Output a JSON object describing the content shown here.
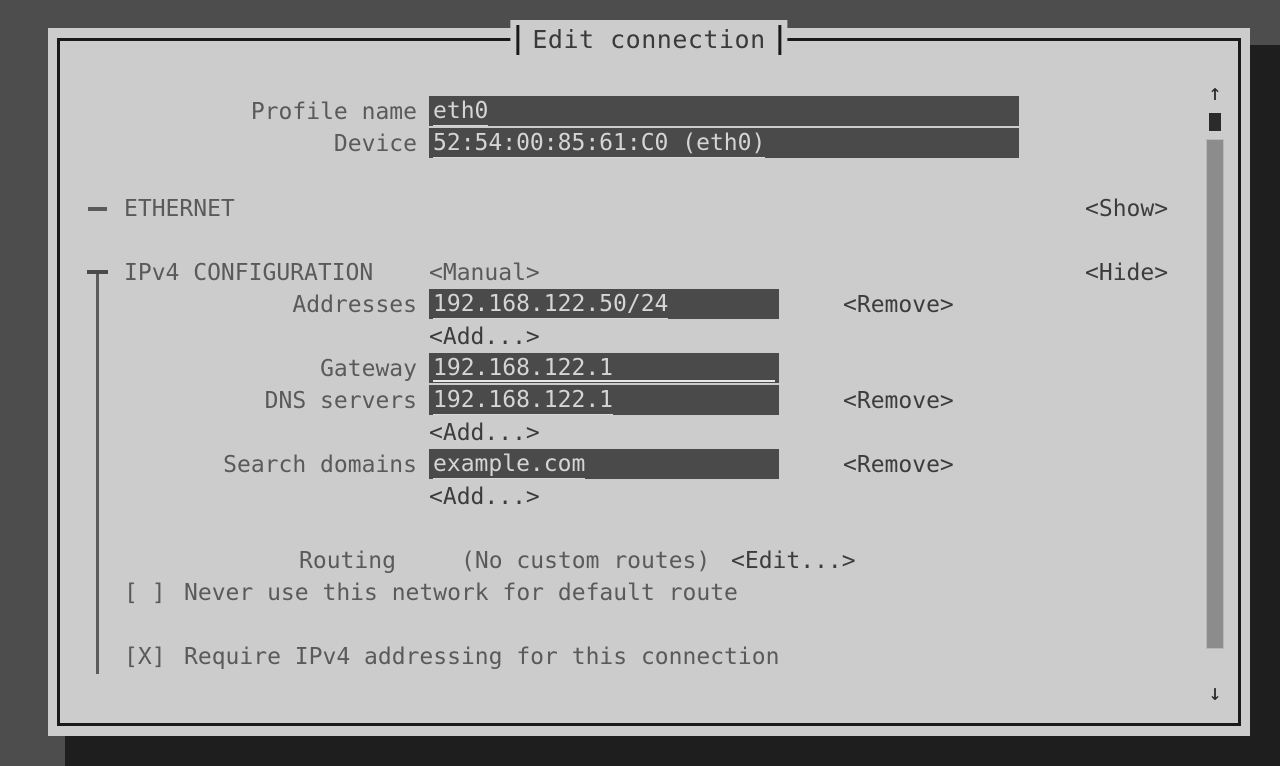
{
  "window": {
    "title": "Edit connection"
  },
  "form": {
    "profile_name": {
      "label": "Profile name",
      "value": "eth0"
    },
    "device": {
      "label": "Device",
      "value": "52:54:00:85:61:C0 (eth0)"
    }
  },
  "sections": [
    {
      "name": "ethernet",
      "label": "ETHERNET",
      "toggle_label": "<Show>",
      "expanded": false
    },
    {
      "name": "ipv4",
      "label": "IPv4 CONFIGURATION",
      "method": "<Manual>",
      "toggle_label": "<Hide>",
      "expanded": true
    }
  ],
  "ipv4": {
    "addresses": {
      "label": "Addresses",
      "value": "192.168.122.50/24",
      "remove_label": "<Remove>",
      "add_label": "<Add...>"
    },
    "gateway": {
      "label": "Gateway",
      "value": "192.168.122.1"
    },
    "dns_servers": {
      "label": "DNS servers",
      "value": "192.168.122.1",
      "remove_label": "<Remove>",
      "add_label": "<Add...>"
    },
    "search_domains": {
      "label": "Search domains",
      "value": "example.com",
      "remove_label": "<Remove>",
      "add_label": "<Add...>"
    },
    "routing": {
      "label": "Routing",
      "status": "(No custom routes)",
      "edit_label": "<Edit...>"
    },
    "never_default": {
      "checkbox": "[ ]",
      "label": "Never use this network for default route",
      "checked": false
    },
    "require_ipv4": {
      "checkbox": "[X]",
      "label": "Require IPv4 addressing for this connection",
      "checked": true
    }
  },
  "scrollbar": {
    "up_arrow": "↑",
    "down_arrow": "↓"
  },
  "colors": {
    "desktop_bg": "#4d4d4d",
    "window_bg": "#cccccc",
    "field_bg": "#4a4a4a",
    "field_text": "#d5d5d5",
    "border": "#1a1a1a",
    "text": "#5a5a5a"
  }
}
